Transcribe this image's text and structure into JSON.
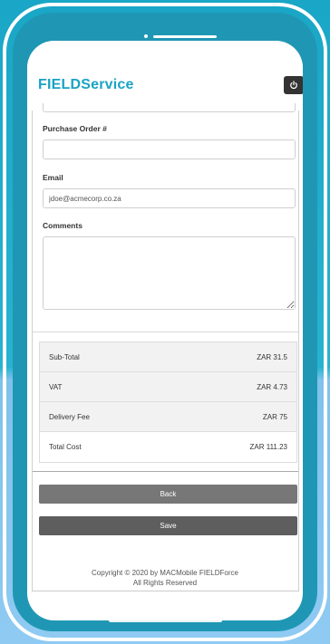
{
  "app": {
    "brand": "FIELDService"
  },
  "form": {
    "purchase_order_label": "Purchase Order #",
    "purchase_order_value": "",
    "email_label": "Email",
    "email_value": "jdoe@acmecorp.co.za",
    "comments_label": "Comments",
    "comments_value": ""
  },
  "totals": [
    {
      "label": "Sub-Total",
      "value": "ZAR 31.5"
    },
    {
      "label": "VAT",
      "value": "ZAR 4.73"
    },
    {
      "label": "Delivery Fee",
      "value": "ZAR 75"
    },
    {
      "label": "Total Cost",
      "value": "ZAR 111.23"
    }
  ],
  "actions": {
    "back_label": "Back",
    "save_label": "Save"
  },
  "footer": {
    "line1": "Copyright © 2020 by MACMobile FIELDForce",
    "line2": "All Rights Reserved"
  },
  "colors": {
    "brand": "#1aa3c4",
    "button_back": "#777777",
    "button_save": "#5e5e5e"
  },
  "icons": {
    "power": "power-icon"
  }
}
